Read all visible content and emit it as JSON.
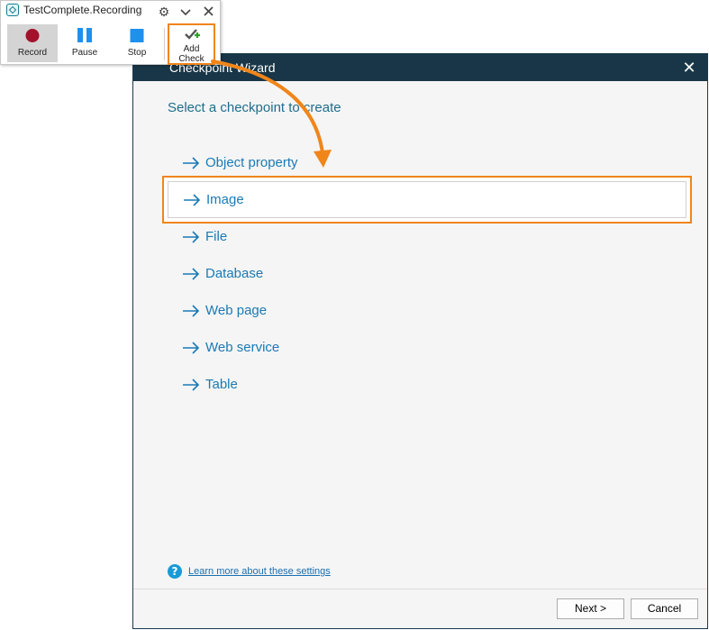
{
  "toolbar": {
    "title": "TestComplete.Recording",
    "settings_icon": "gear-icon",
    "collapse_icon": "chevron-down-icon",
    "close_icon": "close-icon",
    "buttons": {
      "record": "Record",
      "pause": "Pause",
      "stop": "Stop",
      "add_check_line1": "Add",
      "add_check_line2": "Check"
    }
  },
  "wizard": {
    "title": "Checkpoint Wizard",
    "close_glyph": "✕",
    "heading": "Select a checkpoint to create",
    "options": [
      {
        "label": "Object property",
        "selected": false
      },
      {
        "label": "Image",
        "selected": true
      },
      {
        "label": "File",
        "selected": false
      },
      {
        "label": "Database",
        "selected": false
      },
      {
        "label": "Web page",
        "selected": false
      },
      {
        "label": "Web service",
        "selected": false
      },
      {
        "label": "Table",
        "selected": false
      }
    ],
    "learn_more": "Learn more about these settings",
    "help_glyph": "?",
    "next_label": "Next >",
    "cancel_label": "Cancel"
  },
  "colors": {
    "highlight": "#f0851a",
    "titlebar": "#183647",
    "link": "#1a7ab5"
  }
}
